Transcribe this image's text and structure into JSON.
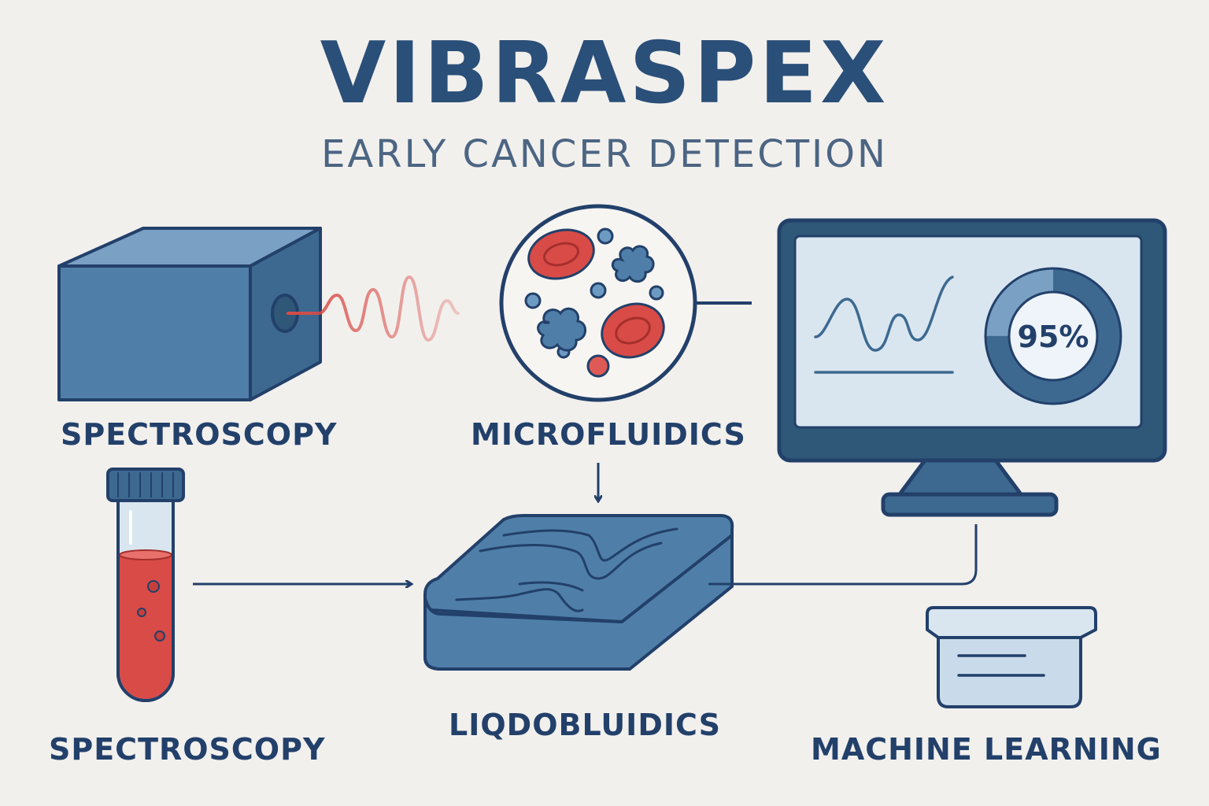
{
  "header": {
    "title": "VIBRASPEX",
    "subtitle": "EARLY CANCER DETECTION"
  },
  "labels": {
    "spectroscopy_device": "SPECTROSCOPY",
    "microfluidics": "MICROFLUIDICS",
    "blood_sample": "SPECTROSCOPY",
    "chip": "LIQDOBLUIDICS",
    "machine_learning": "MACHINE LEARNING"
  },
  "monitor": {
    "percent_label": "95%",
    "donut_fraction": 0.75
  },
  "colors": {
    "navy": "#22406a",
    "blue": "#4f7fa8",
    "light_blue": "#d9e6f0",
    "red": "#d94b47",
    "background": "#f2f0ed"
  }
}
